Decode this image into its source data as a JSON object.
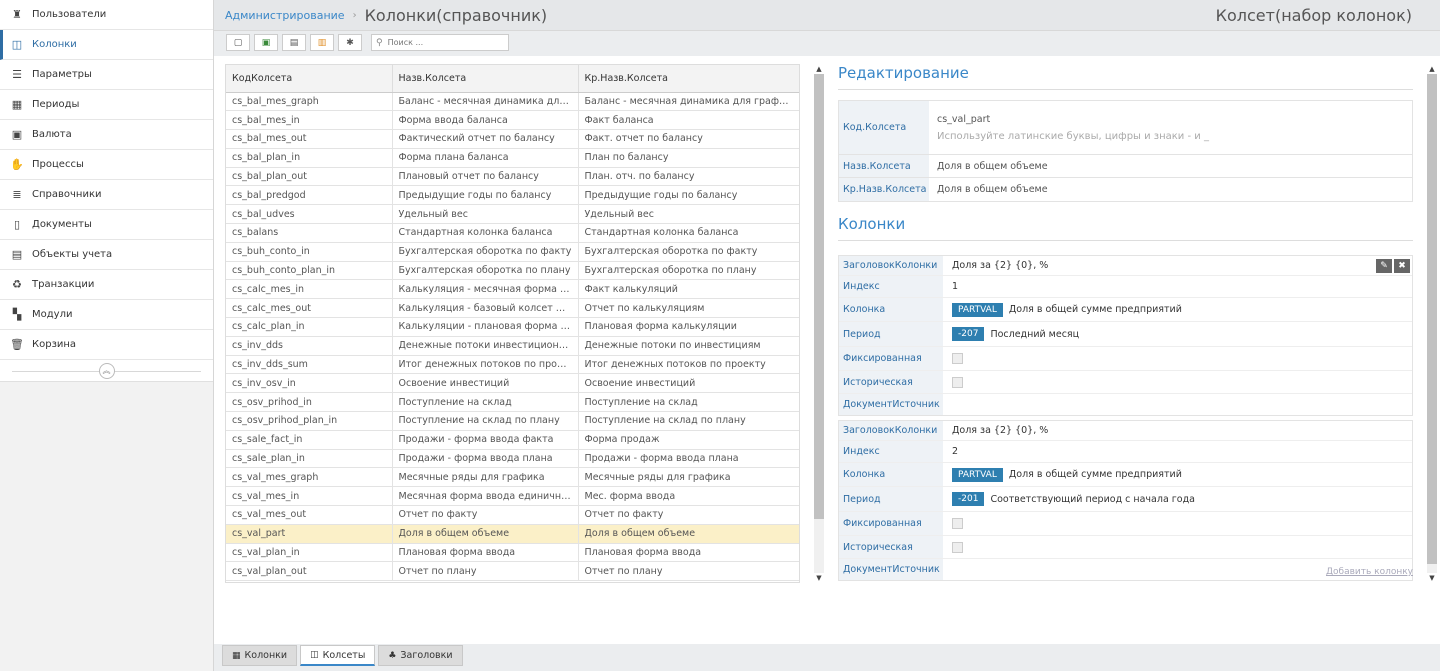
{
  "sidebar": {
    "items": [
      {
        "label": "Пользователи",
        "icon": "user-icon",
        "glyph": "♜"
      },
      {
        "label": "Колонки",
        "icon": "columns-icon",
        "glyph": "◫",
        "active": true
      },
      {
        "label": "Параметры",
        "icon": "sliders-icon",
        "glyph": "☰"
      },
      {
        "label": "Периоды",
        "icon": "calendar-icon",
        "glyph": "▦"
      },
      {
        "label": "Валюта",
        "icon": "money-icon",
        "glyph": "▣"
      },
      {
        "label": "Процессы",
        "icon": "handshake-icon",
        "glyph": "✋"
      },
      {
        "label": "Справочники",
        "icon": "list-icon",
        "glyph": "≣"
      },
      {
        "label": "Документы",
        "icon": "document-icon",
        "glyph": "▯"
      },
      {
        "label": "Объекты учета",
        "icon": "clipboard-icon",
        "glyph": "▤"
      },
      {
        "label": "Транзакции",
        "icon": "recycle-icon",
        "glyph": "♻"
      },
      {
        "label": "Модули",
        "icon": "modules-icon",
        "glyph": "▚"
      },
      {
        "label": "Корзина",
        "icon": "trash-icon",
        "glyph": "🗑"
      }
    ]
  },
  "header": {
    "breadcrumb": "Администрирование",
    "separator": "›",
    "title": "Колонки(справочник)",
    "right_title": "Колсет(набор колонок)"
  },
  "toolbar": {
    "search_placeholder": "Поиск ..."
  },
  "table": {
    "columns": [
      "КодКолсета",
      "Назв.Колсета",
      "Кр.Назв.Колсета"
    ],
    "rows": [
      [
        "cs_bal_mes_graph",
        "Баланс - месячная динамика для графика",
        "Баланс - месячная динамика для графика"
      ],
      [
        "cs_bal_mes_in",
        "Форма ввода баланса",
        "Факт баланса"
      ],
      [
        "cs_bal_mes_out",
        "Фактический отчет по балансу",
        "Факт. отчет по балансу"
      ],
      [
        "cs_bal_plan_in",
        "Форма плана баланса",
        "План по балансу"
      ],
      [
        "cs_bal_plan_out",
        "Плановый отчет по балансу",
        "План. отч. по балансу"
      ],
      [
        "cs_bal_predgod",
        "Предыдущие годы по балансу",
        "Предыдущие годы по балансу"
      ],
      [
        "cs_bal_udves",
        "Удельный вес",
        "Удельный вес"
      ],
      [
        "cs_balans",
        "Стандартная колонка баланса",
        "Стандартная колонка баланса"
      ],
      [
        "cs_buh_conto_in",
        "Бухгалтерская оборотка по факту",
        "Бухгалтерская оборотка по факту"
      ],
      [
        "cs_buh_conto_plan_in",
        "Бухгалтерская оборотка по плану",
        "Бухгалтерская оборотка по плану"
      ],
      [
        "cs_calc_mes_in",
        "Калькуляция - месячная форма ввода",
        "Факт калькуляций"
      ],
      [
        "cs_calc_mes_out",
        "Калькуляция - базовый колсет для отчета",
        "Отчет по калькуляциям"
      ],
      [
        "cs_calc_plan_in",
        "Калькуляции - плановая форма ввода",
        "Плановая форма калькуляции"
      ],
      [
        "cs_inv_dds",
        "Денежные потоки инвестиционные",
        "Денежные потоки по инвестициям"
      ],
      [
        "cs_inv_dds_sum",
        "Итог денежных потоков по проекту",
        "Итог денежных потоков по проекту"
      ],
      [
        "cs_inv_osv_in",
        "Освоение инвестиций",
        "Освоение инвестиций"
      ],
      [
        "cs_osv_prihod_in",
        "Поступление на склад",
        "Поступление на склад"
      ],
      [
        "cs_osv_prihod_plan_in",
        "Поступление на склад по плану",
        "Поступление на склад по плану"
      ],
      [
        "cs_sale_fact_in",
        "Продажи - форма ввода факта",
        "Форма продаж"
      ],
      [
        "cs_sale_plan_in",
        "Продажи - форма ввода плана",
        "Продажи - форма ввода плана"
      ],
      [
        "cs_val_mes_graph",
        "Месячные ряды для графика",
        "Месячные ряды для графика"
      ],
      [
        "cs_val_mes_in",
        "Месячная форма ввода единичных",
        "Мес. форма ввода"
      ],
      [
        "cs_val_mes_out",
        "Отчет по факту",
        "Отчет по факту"
      ],
      [
        "cs_val_part",
        "Доля в общем объеме",
        "Доля в общем объеме"
      ],
      [
        "cs_val_plan_in",
        "Плановая форма ввода",
        "Плановая форма ввода"
      ],
      [
        "cs_val_plan_out",
        "Отчет по плану",
        "Отчет по плану"
      ]
    ],
    "selected_code": "cs_val_part"
  },
  "edit": {
    "title": "Редактирование",
    "code_label": "Код.Колсета",
    "code_value": "cs_val_part",
    "code_hint": "Используйте латинские буквы, цифры и знаки - и _",
    "name_label": "Назв.Колсета",
    "name_value": "Доля в общем объеме",
    "short_label": "Кр.Назв.Колсета",
    "short_value": "Доля в общем объеме"
  },
  "columns_section": {
    "title": "Колонки",
    "labels": {
      "header": "ЗаголовокКолонки",
      "index": "Индекс",
      "column": "Колонка",
      "period": "Период",
      "fixed": "Фиксированная",
      "historical": "Историческая",
      "doc_source": "ДокументИсточник"
    },
    "items": [
      {
        "header": "Доля за {2} {0}, %",
        "index": "1",
        "column_code": "PARTVAL",
        "column_name": "Доля в общей сумме предприятий",
        "period_code": "-207",
        "period_name": "Последний месяц",
        "fixed": false,
        "historical": false,
        "doc_source": ""
      },
      {
        "header": "Доля за {2} {0}, %",
        "index": "2",
        "column_code": "PARTVAL",
        "column_name": "Доля в общей сумме предприятий",
        "period_code": "-201",
        "period_name": "Соответствующий период с начала года",
        "fixed": false,
        "historical": false,
        "doc_source": ""
      }
    ],
    "add_label": "Добавить колонку"
  },
  "bottom_tabs": [
    {
      "label": "Колонки",
      "icon": "table-icon",
      "glyph": "▦"
    },
    {
      "label": "Колсеты",
      "icon": "columns-icon",
      "glyph": "◫",
      "active": true
    },
    {
      "label": "Заголовки",
      "icon": "hierarchy-icon",
      "glyph": "♣"
    }
  ],
  "colors": {
    "accent": "#3a87c8",
    "badge": "#2e7fb0",
    "selected_row": "#fbf0c8",
    "label_bg": "#eef2f6"
  }
}
